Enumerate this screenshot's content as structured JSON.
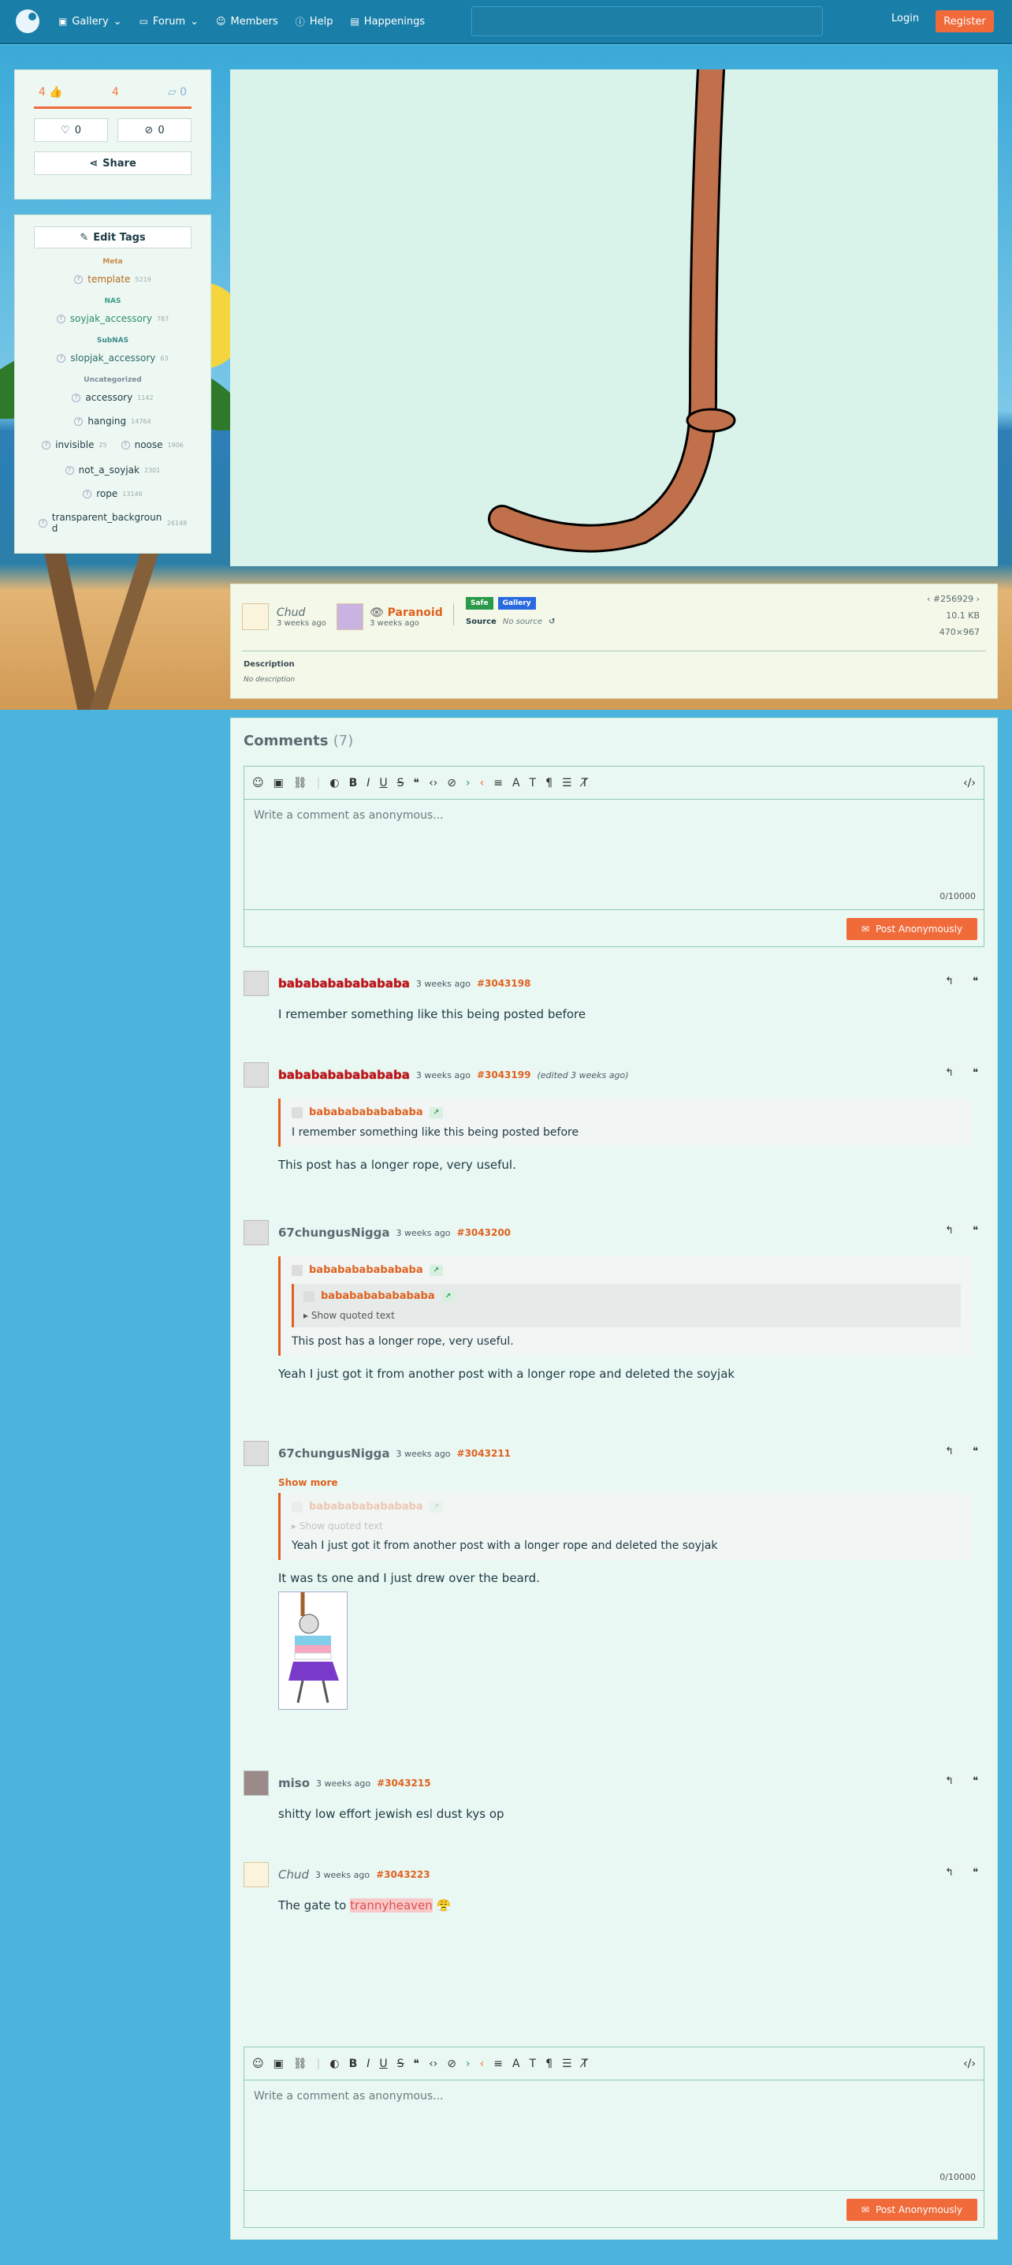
{
  "nav": {
    "gallery": "Gallery",
    "forum": "Forum",
    "members": "Members",
    "help": "Help",
    "happenings": "Happenings",
    "login": "Login",
    "register": "Register"
  },
  "votes": {
    "up": "4",
    "score": "4",
    "down": "0",
    "fav": "0",
    "hidden": "0",
    "share": "Share"
  },
  "tags": {
    "edit": "Edit Tags",
    "cat_meta": "Meta",
    "cat_nas": "NAS",
    "cat_subnas": "SubNAS",
    "cat_unc": "Uncategorized",
    "items": [
      {
        "name": "template",
        "count": "5219"
      },
      {
        "name": "soyjak_accessory",
        "count": "787"
      },
      {
        "name": "slopjak_accessory",
        "count": "63"
      },
      {
        "name": "accessory",
        "count": "1142"
      },
      {
        "name": "hanging",
        "count": "14764"
      },
      {
        "name": "invisible",
        "count": "25"
      },
      {
        "name": "noose",
        "count": "1906"
      },
      {
        "name": "not_a_soyjak",
        "count": "2301"
      },
      {
        "name": "rope",
        "count": "13146"
      },
      {
        "name": "transparent_background",
        "count": "26148"
      }
    ]
  },
  "meta": {
    "uploader": "Chud",
    "uploaded": "3 weeks ago",
    "approver": "Paranoid",
    "approved": "3 weeks ago",
    "rating": "Safe",
    "category": "Gallery",
    "source_label": "Source",
    "source": "No source",
    "post_id": "#256929",
    "size": "10.1 KB",
    "dims": "470×967",
    "desc_label": "Description",
    "desc": "No description"
  },
  "comments": {
    "title": "Comments",
    "count": "(7)",
    "placeholder": "Write a comment as anonymous...",
    "counter": "0/10000",
    "post": "Post Anonymously",
    "show_more": "Show more",
    "show_quoted": "Show quoted text",
    "c1": {
      "user": "babababababababa",
      "time": "3 weeks ago",
      "id": "#3043198",
      "body": "I remember something like this being posted before"
    },
    "c2": {
      "user": "babababababababa",
      "time": "3 weeks ago",
      "id": "#3043199",
      "edited": "(edited 3 weeks ago)",
      "quote_user": "babababababababa",
      "quote": "I remember something like this being posted before",
      "body": "This post has a longer rope, very useful."
    },
    "c3": {
      "user": "67chungusNigga",
      "time": "3 weeks ago",
      "id": "#3043200",
      "quote_user": "babababababababa",
      "quote2_user": "babababababababa",
      "quote": "This post has a longer rope, very useful.",
      "body": "Yeah I just got it from another post with a longer rope and deleted the soyjak"
    },
    "c4": {
      "user": "67chungusNigga",
      "time": "3 weeks ago",
      "id": "#3043211",
      "quote_user": "babababababababa",
      "quote": "Yeah I just got it from another post with a longer rope and deleted the soyjak",
      "body": "It was ts one and I just drew over the beard."
    },
    "c5": {
      "user": "miso",
      "time": "3 weeks ago",
      "id": "#3043215",
      "body": "shitty low effort jewish esl dust kys op"
    },
    "c6": {
      "user": "Chud",
      "time": "3 weeks ago",
      "id": "#3043223",
      "body": "The gate to ",
      "link": "trannyheaven",
      "emoji": "😤"
    }
  }
}
